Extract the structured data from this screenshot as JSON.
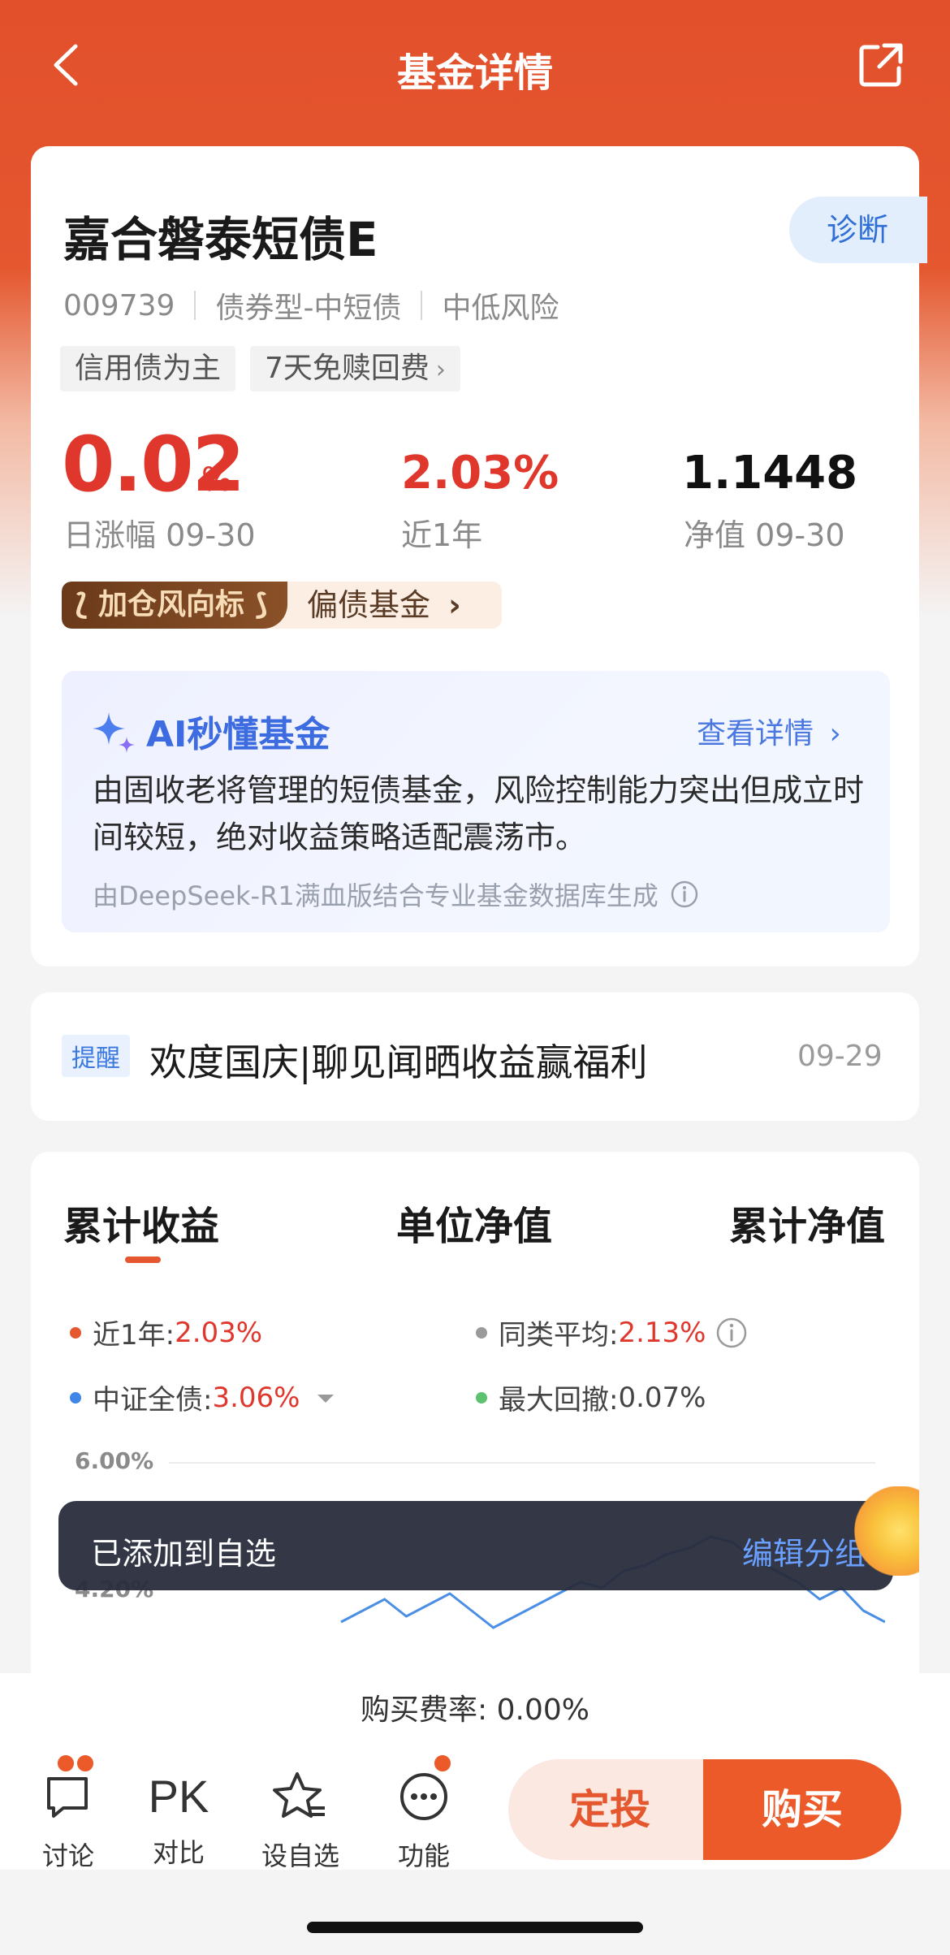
{
  "header": {
    "title": "基金详情"
  },
  "fund": {
    "name": "嘉合磐泰短债E",
    "diagnose_label": "诊断",
    "code": "009739",
    "type": "债券型-中短债",
    "risk": "中低风险",
    "tags": [
      "信用债为主",
      "7天免赎回费"
    ],
    "daily_change": {
      "value": "0.02",
      "unit": "%",
      "label": "日涨幅 09-30"
    },
    "one_year": {
      "value": "2.03%",
      "label": "近1年"
    },
    "nav": {
      "value": "1.1448",
      "label": "净值 09-30"
    },
    "banner": {
      "left": "加仓风向标",
      "right": "偏债基金"
    }
  },
  "ai": {
    "title": "AI秒懂基金",
    "more": "查看详情",
    "text": "由固收老将管理的短债基金，风险控制能力突出但成立时间较短，绝对收益策略适配震荡市。",
    "footnote": "由DeepSeek-R1满血版结合专业基金数据库生成"
  },
  "notice": {
    "tag": "提醒",
    "text": "欢度国庆|聊见闻晒收益赢福利",
    "date": "09-29"
  },
  "chart_tabs": [
    "累计收益",
    "单位净值",
    "累计净值"
  ],
  "legend": {
    "one_year": {
      "label": "近1年:",
      "value": "2.03%"
    },
    "peer_avg": {
      "label": "同类平均:",
      "value": "2.13%"
    },
    "index": {
      "label": "中证全债:",
      "value": "3.06%"
    },
    "max_drawdown": {
      "label": "最大回撤:",
      "value": "0.07%"
    }
  },
  "colors": {
    "accent": "#e4572f",
    "red": "#e0372d",
    "blue": "#3d6be0",
    "line": "#4a8ee6"
  },
  "chart_data": {
    "type": "line",
    "y_tick_labels": [
      "6.00%",
      "4.20%"
    ],
    "series": [
      {
        "name": "近1年",
        "values": [
          2.9,
          3.1,
          3.3,
          3.0,
          3.2,
          3.4,
          3.1,
          2.8,
          3.0,
          3.2,
          3.4,
          3.6,
          3.5,
          3.8,
          3.9,
          4.1,
          4.2,
          4.4,
          4.3,
          4.0,
          3.8,
          3.6,
          3.3,
          3.5,
          3.1,
          2.9
        ]
      }
    ]
  },
  "toast": {
    "text": "已添加到自选",
    "action": "编辑分组"
  },
  "fee": "购买费率: 0.00%",
  "bottom_nav": [
    {
      "label": "讨论",
      "icon": "chat-icon"
    },
    {
      "label": "对比",
      "icon": "PK"
    },
    {
      "label": "设自选",
      "icon": "star-list-icon"
    },
    {
      "label": "功能",
      "icon": "more-icon"
    }
  ],
  "actions": {
    "fixed_invest": "定投",
    "buy": "购买"
  }
}
